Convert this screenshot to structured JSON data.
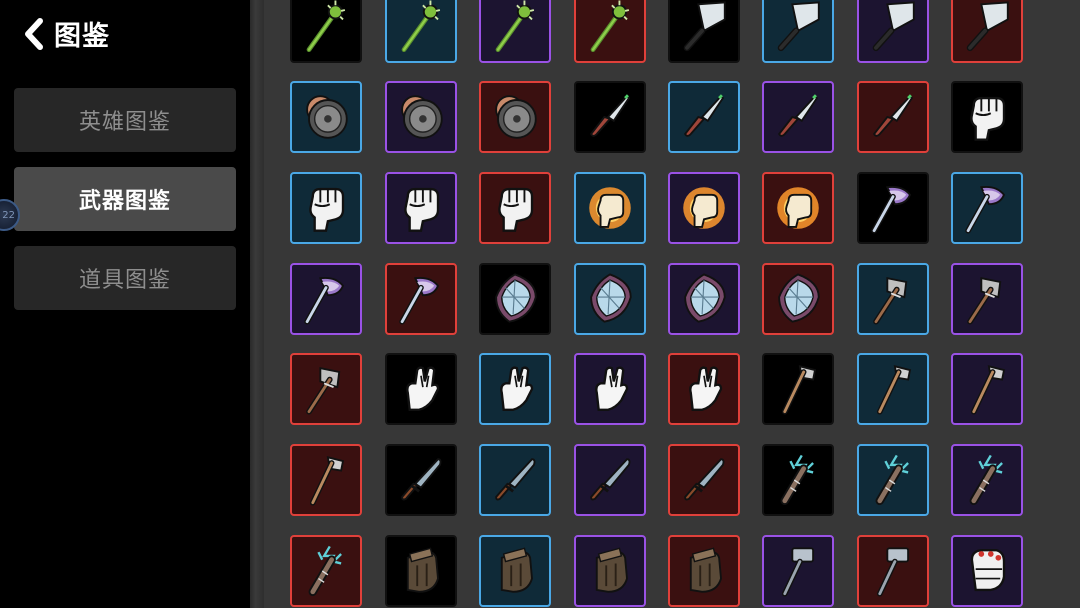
{
  "header": {
    "title": "图鉴"
  },
  "sidebar": {
    "items": [
      {
        "label": "英雄图鉴",
        "active": false
      },
      {
        "label": "武器图鉴",
        "active": true
      },
      {
        "label": "道具图鉴",
        "active": false
      }
    ],
    "float_badge": "22"
  },
  "colors": {
    "blue": "#4aa8e6",
    "purple": "#9a52e6",
    "red": "#e0403a",
    "black": "#111111",
    "panel": "#373737"
  },
  "weapons": {
    "rows": [
      [
        {
          "icon": "spiked-club-icon",
          "rarity": "black"
        },
        {
          "icon": "spiked-club-icon",
          "rarity": "blue"
        },
        {
          "icon": "spiked-club-icon",
          "rarity": "purple"
        },
        {
          "icon": "spiked-club-icon",
          "rarity": "red"
        },
        {
          "icon": "cleaver-icon",
          "rarity": "black"
        },
        {
          "icon": "cleaver-icon",
          "rarity": "blue"
        },
        {
          "icon": "cleaver-icon",
          "rarity": "purple"
        },
        {
          "icon": "cleaver-icon",
          "rarity": "red"
        }
      ],
      [
        {
          "icon": "saw-blade-icon",
          "rarity": "blue"
        },
        {
          "icon": "saw-blade-icon",
          "rarity": "purple"
        },
        {
          "icon": "saw-blade-icon",
          "rarity": "red"
        },
        {
          "icon": "knife-icon",
          "rarity": "black"
        },
        {
          "icon": "knife-icon",
          "rarity": "blue"
        },
        {
          "icon": "knife-icon",
          "rarity": "purple"
        },
        {
          "icon": "knife-icon",
          "rarity": "red"
        },
        {
          "icon": "fist-icon",
          "rarity": "black"
        }
      ],
      [
        {
          "icon": "fist-icon",
          "rarity": "blue"
        },
        {
          "icon": "fist-icon",
          "rarity": "purple"
        },
        {
          "icon": "fist-icon",
          "rarity": "red"
        },
        {
          "icon": "flaming-fist-icon",
          "rarity": "blue"
        },
        {
          "icon": "flaming-fist-icon",
          "rarity": "purple"
        },
        {
          "icon": "flaming-fist-icon",
          "rarity": "red"
        },
        {
          "icon": "magic-axe-icon",
          "rarity": "black"
        },
        {
          "icon": "magic-axe-icon",
          "rarity": "blue"
        }
      ],
      [
        {
          "icon": "magic-axe-icon",
          "rarity": "purple"
        },
        {
          "icon": "magic-axe-icon",
          "rarity": "red"
        },
        {
          "icon": "crystal-shield-icon",
          "rarity": "black"
        },
        {
          "icon": "crystal-shield-icon",
          "rarity": "blue"
        },
        {
          "icon": "crystal-shield-icon",
          "rarity": "purple"
        },
        {
          "icon": "crystal-shield-icon",
          "rarity": "red"
        },
        {
          "icon": "stone-axe-icon",
          "rarity": "blue"
        },
        {
          "icon": "stone-axe-icon",
          "rarity": "purple"
        }
      ],
      [
        {
          "icon": "stone-axe-icon",
          "rarity": "red"
        },
        {
          "icon": "open-hand-icon",
          "rarity": "black"
        },
        {
          "icon": "open-hand-icon",
          "rarity": "blue"
        },
        {
          "icon": "open-hand-icon",
          "rarity": "purple"
        },
        {
          "icon": "open-hand-icon",
          "rarity": "red"
        },
        {
          "icon": "hatchet-icon",
          "rarity": "black"
        },
        {
          "icon": "hatchet-icon",
          "rarity": "blue"
        },
        {
          "icon": "hatchet-icon",
          "rarity": "purple"
        }
      ],
      [
        {
          "icon": "hatchet-icon",
          "rarity": "red"
        },
        {
          "icon": "machete-icon",
          "rarity": "black"
        },
        {
          "icon": "machete-icon",
          "rarity": "blue"
        },
        {
          "icon": "machete-icon",
          "rarity": "purple"
        },
        {
          "icon": "machete-icon",
          "rarity": "red"
        },
        {
          "icon": "lightning-club-icon",
          "rarity": "black"
        },
        {
          "icon": "lightning-club-icon",
          "rarity": "blue"
        },
        {
          "icon": "lightning-club-icon",
          "rarity": "purple"
        }
      ],
      [
        {
          "icon": "lightning-club-icon",
          "rarity": "red"
        },
        {
          "icon": "leather-glove-icon",
          "rarity": "black"
        },
        {
          "icon": "leather-glove-icon",
          "rarity": "blue"
        },
        {
          "icon": "leather-glove-icon",
          "rarity": "purple"
        },
        {
          "icon": "leather-glove-icon",
          "rarity": "red"
        },
        {
          "icon": "hammer-icon",
          "rarity": "purple"
        },
        {
          "icon": "hammer-icon",
          "rarity": "red"
        },
        {
          "icon": "boxing-glove-icon",
          "rarity": "purple"
        }
      ]
    ]
  }
}
